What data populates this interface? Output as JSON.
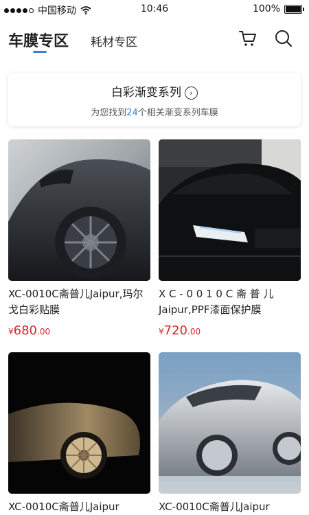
{
  "status": {
    "carrier": "中国移动",
    "time": "10:46",
    "battery": "100%",
    "battery_level": 1.0
  },
  "nav": {
    "tab_active": "车膜专区",
    "tab_other": "耗材专区",
    "cart_icon": "cart-icon",
    "search_icon": "search-icon",
    "underline_color": "#3d7fd6"
  },
  "banner": {
    "title": "白彩渐变系列",
    "sub_prefix": "为您找到",
    "sub_count": "24",
    "sub_suffix": "个相关渐变系列车膜",
    "count_color": "#3d7fd6"
  },
  "products": [
    {
      "name": "XC-0010C斋普儿Jaipur,玛尔戈白彩贴膜",
      "currency": "¥",
      "price_int": "680",
      "price_dec": ".00"
    },
    {
      "name": "X C - 0 0 1 0 C 斋 普 儿 Jaipur,PPF漆面保护膜",
      "currency": "¥",
      "price_int": "720",
      "price_dec": ".00"
    },
    {
      "name": "XC-0010C斋普儿Jaipur"
    },
    {
      "name": "XC-0010C斋普儿Jaipur"
    }
  ],
  "price_color": "#d8242a"
}
